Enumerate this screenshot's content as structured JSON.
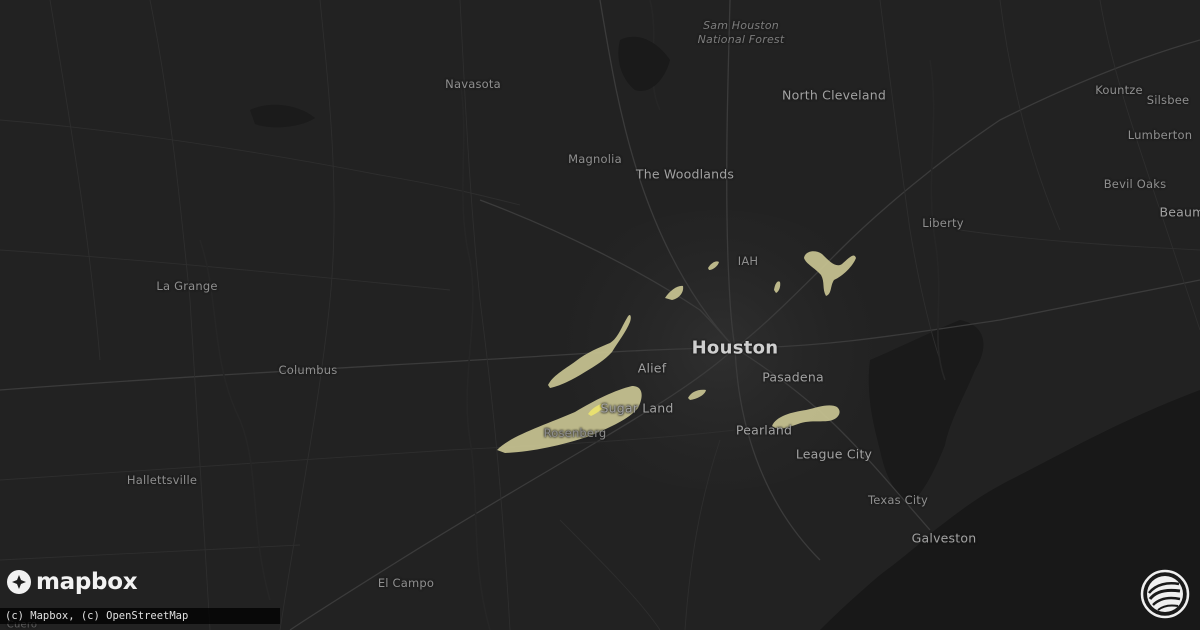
{
  "map": {
    "places": [
      {
        "id": "sam-houston",
        "text": "Sam Houston\nNational Forest",
        "style": "italic"
      },
      {
        "id": "navasota",
        "text": "Navasota",
        "style": "small"
      },
      {
        "id": "north-cleveland",
        "text": "North Cleveland",
        "style": "mid"
      },
      {
        "id": "kountze",
        "text": "Kountze",
        "style": "small"
      },
      {
        "id": "silsbee",
        "text": "Silsbee",
        "style": "small"
      },
      {
        "id": "lumberton",
        "text": "Lumberton",
        "style": "small"
      },
      {
        "id": "magnolia",
        "text": "Magnolia",
        "style": "small"
      },
      {
        "id": "the-woodlands",
        "text": "The Woodlands",
        "style": "mid"
      },
      {
        "id": "bevil-oaks",
        "text": "Bevil Oaks",
        "style": "small"
      },
      {
        "id": "beaumont",
        "text": "Beaum",
        "style": "mid"
      },
      {
        "id": "liberty",
        "text": "Liberty",
        "style": "small"
      },
      {
        "id": "iah",
        "text": "IAH",
        "style": "small"
      },
      {
        "id": "la-grange",
        "text": "La Grange",
        "style": "small"
      },
      {
        "id": "houston",
        "text": "Houston",
        "style": "big"
      },
      {
        "id": "columbus",
        "text": "Columbus",
        "style": "small"
      },
      {
        "id": "alief",
        "text": "Alief",
        "style": "mid"
      },
      {
        "id": "pasadena",
        "text": "Pasadena",
        "style": "mid"
      },
      {
        "id": "sugar-land",
        "text": "Sugar Land",
        "style": "mid"
      },
      {
        "id": "rosenberg",
        "text": "Rosenberg",
        "style": "small"
      },
      {
        "id": "pearland",
        "text": "Pearland",
        "style": "mid"
      },
      {
        "id": "hallettsville",
        "text": "Hallettsville",
        "style": "small"
      },
      {
        "id": "league-city",
        "text": "League City",
        "style": "mid"
      },
      {
        "id": "texas-city",
        "text": "Texas City",
        "style": "small"
      },
      {
        "id": "galveston",
        "text": "Galveston",
        "style": "mid"
      },
      {
        "id": "el-campo",
        "text": "El Campo",
        "style": "small"
      },
      {
        "id": "cuero",
        "text": "Cuero",
        "style": "dim"
      }
    ],
    "swath_color": "#c9c493",
    "swath_core_color": "#e8e070",
    "land_color": "#232323",
    "water_color": "#161616"
  },
  "logo": {
    "text": "mapbox"
  },
  "attribution": "(c) Mapbox, (c) OpenStreetMap",
  "brand_icon": "globe-swirl-icon"
}
